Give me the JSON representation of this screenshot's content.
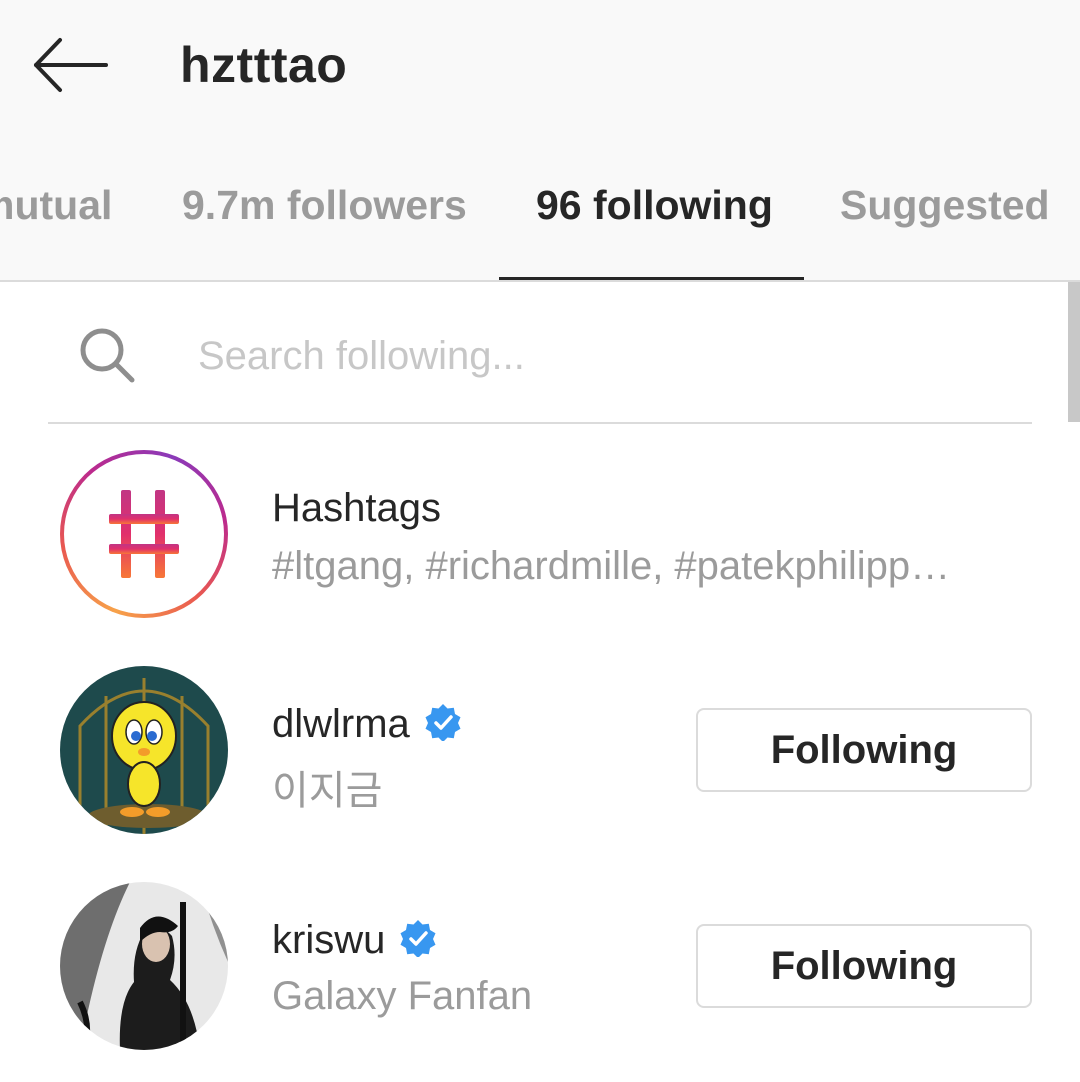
{
  "header": {
    "title": "hztttao",
    "back_icon": "arrow-left-icon"
  },
  "tabs": [
    {
      "label": "mutual",
      "active": false
    },
    {
      "label": "9.7m followers",
      "active": false
    },
    {
      "label": "96 following",
      "active": true
    },
    {
      "label": "Suggested",
      "active": false
    }
  ],
  "search": {
    "placeholder": "Search following...",
    "value": "",
    "icon": "search-icon"
  },
  "hashtags": {
    "title": "Hashtags",
    "subtitle": "#ltgang, #richardmille, #patekphilipp…",
    "icon": "hashtag-icon"
  },
  "following": [
    {
      "username": "dlwlrma",
      "verified": true,
      "full_name": "이지금",
      "button_label": "Following",
      "avatar": "tweety-bird-avatar"
    },
    {
      "username": "kriswu",
      "verified": true,
      "full_name": "Galaxy Fanfan",
      "button_label": "Following",
      "avatar": "kriswu-avatar"
    }
  ],
  "colors": {
    "verified_blue": "#3897f0",
    "text_primary": "#262626",
    "text_secondary": "#9b9b9b",
    "header_bg": "#f9f9f9",
    "border": "#dbdbdb"
  }
}
